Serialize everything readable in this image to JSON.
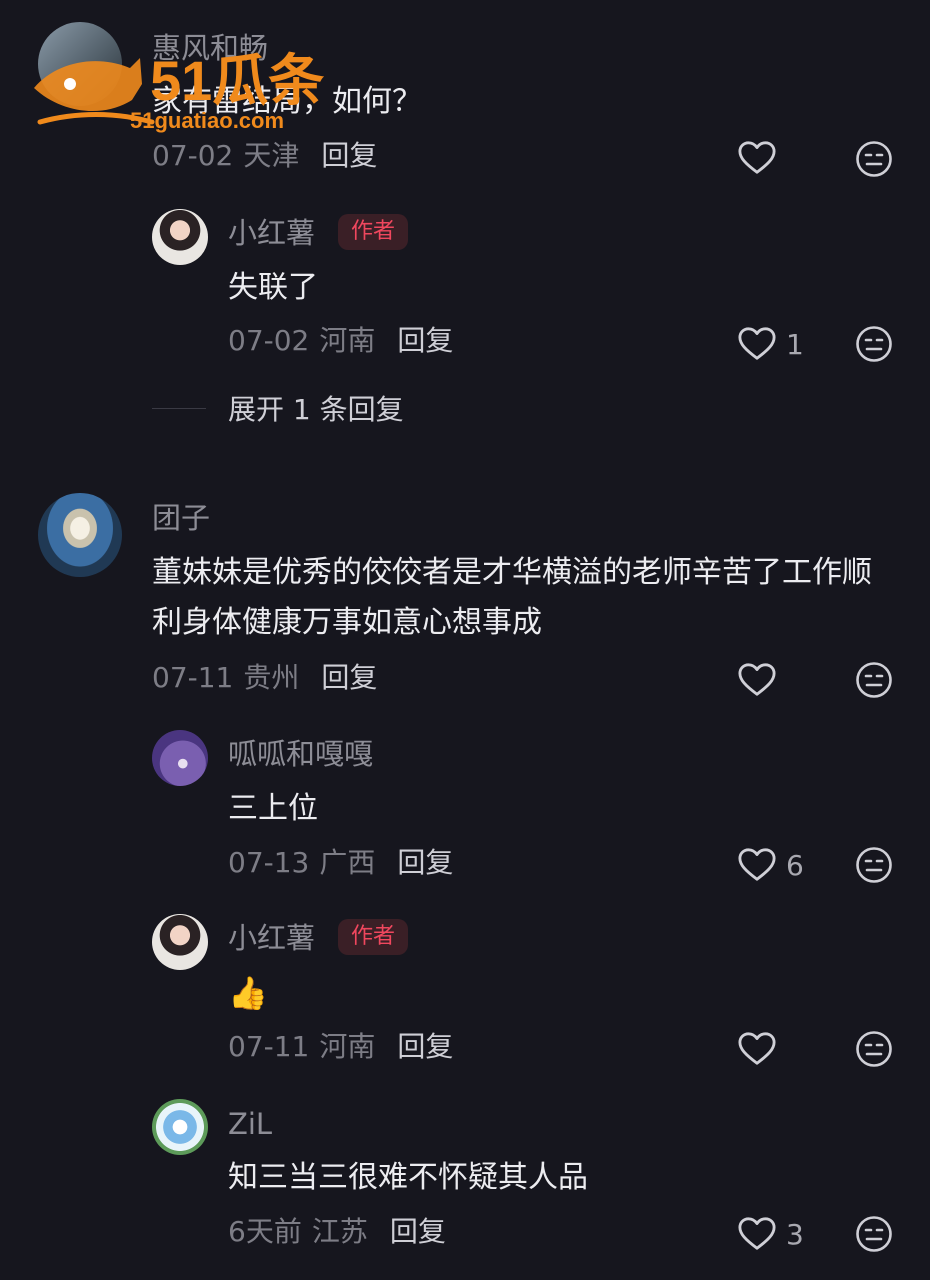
{
  "comments": [
    {
      "user": "惠风和畅",
      "text": "家有雷结局，如何？",
      "date": "07-02",
      "location": "天津",
      "reply_label": "回复",
      "likes": "",
      "replies": [
        {
          "user": "小红薯",
          "badge": "作者",
          "text": "失联了",
          "date": "07-02",
          "location": "河南",
          "reply_label": "回复",
          "likes": "1"
        }
      ],
      "expand_label": "展开 1 条回复"
    },
    {
      "user": "团子",
      "text": "董妹妹是优秀的佼佼者是才华横溢的老师辛苦了工作顺利身体健康万事如意心想事成",
      "date": "07-11",
      "location": "贵州",
      "reply_label": "回复",
      "likes": "",
      "replies": [
        {
          "user": "呱呱和嘎嘎",
          "text": "三上位",
          "date": "07-13",
          "location": "广西",
          "reply_label": "回复",
          "likes": "6"
        },
        {
          "user": "小红薯",
          "badge": "作者",
          "text": "👍",
          "date": "07-11",
          "location": "河南",
          "reply_label": "回复",
          "likes": ""
        },
        {
          "user": "ZiL",
          "text": "知三当三很难不怀疑其人品",
          "date": "6天前",
          "location": "江苏",
          "reply_label": "回复",
          "likes": "3"
        }
      ]
    }
  ],
  "watermark": {
    "brand": "51瓜条",
    "url": "51guatiao.com"
  },
  "colors": {
    "background": "#16161e",
    "author_badge": "#f0475e",
    "watermark": "#f08a1c"
  },
  "icons": [
    "heart-outline-icon",
    "dislike-face-icon"
  ]
}
